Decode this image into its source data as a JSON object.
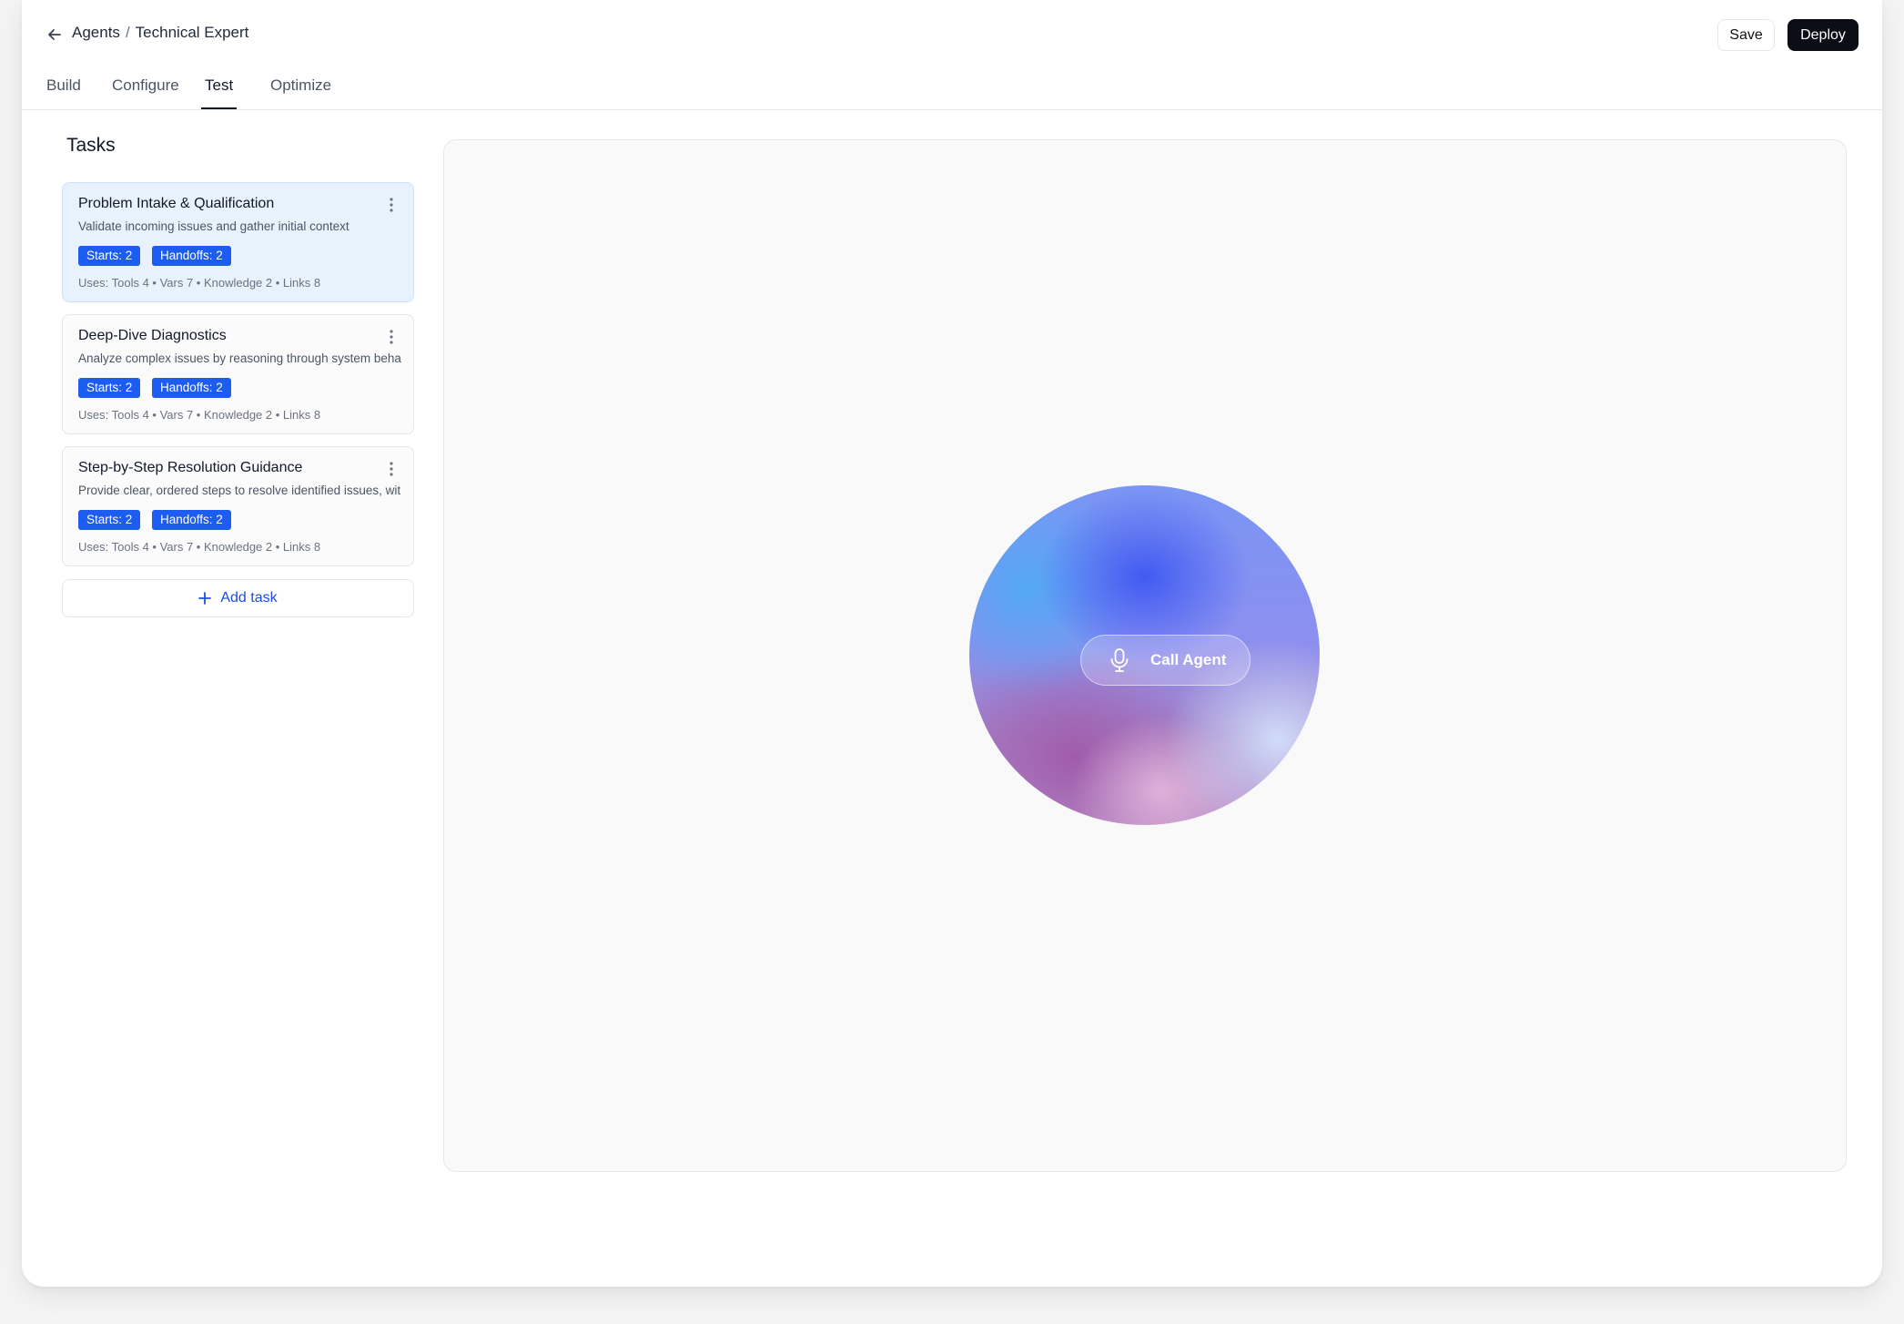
{
  "header": {
    "breadcrumb": [
      "Agents",
      "/",
      "Technical Expert"
    ],
    "save_label": "Save",
    "deploy_label": "Deploy"
  },
  "tabs": [
    {
      "label": "Build",
      "active": false
    },
    {
      "label": "Configure",
      "active": false
    },
    {
      "label": "Test",
      "active": true
    },
    {
      "label": "Optimize",
      "active": false
    }
  ],
  "tasks_panel": {
    "title": "Tasks",
    "add_label": "Add task",
    "items": [
      {
        "title": "Problem Intake & Qualification",
        "description": "Validate incoming issues and gather initial context",
        "starts": "Starts: 2",
        "handoffs": "Handoffs: 2",
        "uses": "Uses: Tools 4 • Vars 7 • Knowledge 2 • Links 8",
        "selected": true
      },
      {
        "title": "Deep-Dive Diagnostics",
        "description": "Analyze complex issues by reasoning through system beha",
        "starts": "Starts: 2",
        "handoffs": "Handoffs: 2",
        "uses": "Uses: Tools 4 • Vars 7 • Knowledge 2 • Links 8",
        "selected": false
      },
      {
        "title": "Step-by-Step Resolution Guidance",
        "description": "Provide clear, ordered steps to resolve identified issues, wit",
        "starts": "Starts: 2",
        "handoffs": "Handoffs: 2",
        "uses": "Uses: Tools 4 • Vars 7 • Knowledge 2 • Links 8",
        "selected": false
      }
    ]
  },
  "test_panel": {
    "call_label": "Call Agent"
  },
  "colors": {
    "accent": "#1d5cf0",
    "deploy_bg": "#0b0d17",
    "selected_card": "#e8f2fd"
  },
  "icons": [
    "arrow-left-icon",
    "more-vertical-icon",
    "plus-icon",
    "microphone-icon"
  ]
}
